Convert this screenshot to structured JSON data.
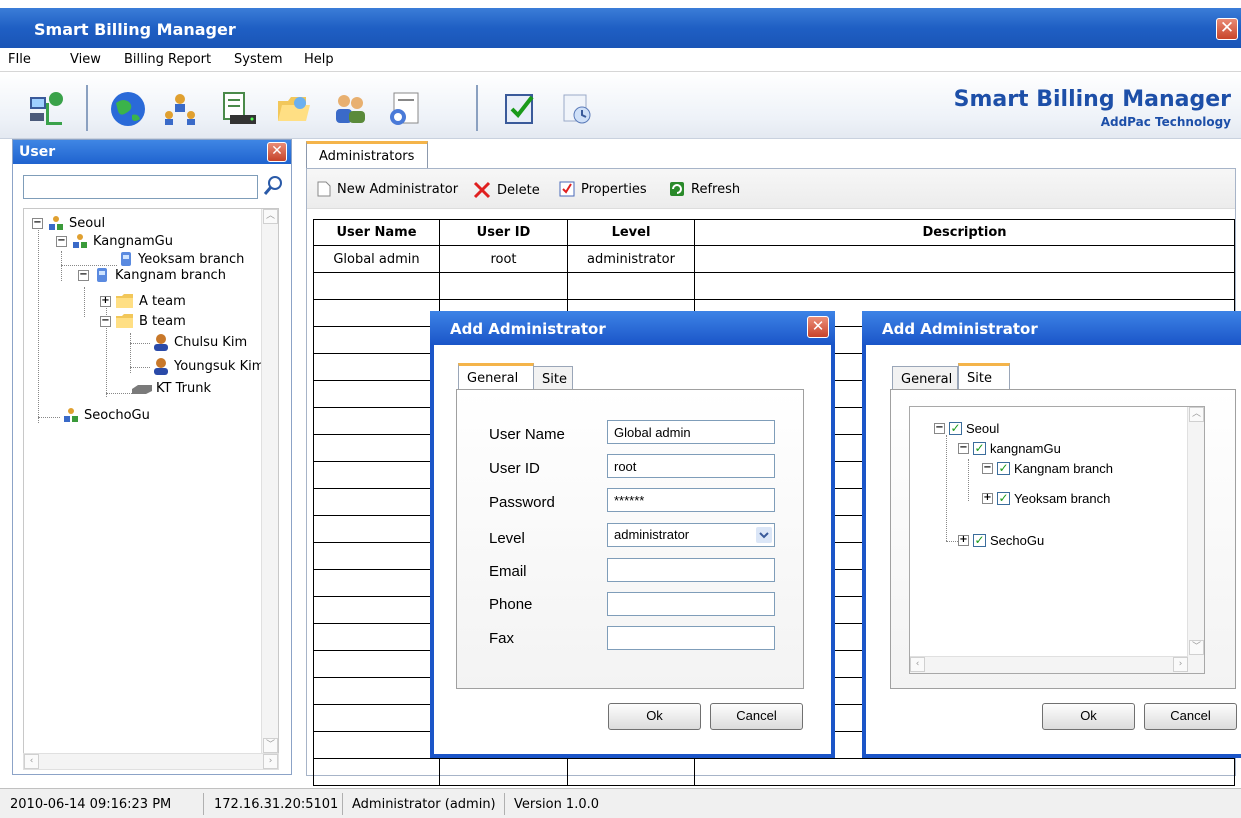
{
  "window": {
    "title": "Smart Billing Manager"
  },
  "menu": [
    "FIle",
    "View",
    "Billing Report",
    "System",
    "Help"
  ],
  "toolbar": {
    "icons": [
      "network-icon",
      "globe-icon",
      "users-network-icon",
      "device-icon",
      "folder-icon",
      "users-icon",
      "user-card-icon",
      "checklist-icon",
      "report-icon"
    ],
    "brand_title": "Smart Billing Manager",
    "brand_subtitle": "AddPac Technology"
  },
  "user_panel": {
    "title": "User",
    "search_value": "",
    "tree": [
      {
        "label": "Seoul"
      },
      {
        "label": "KangnamGu"
      },
      {
        "label": "Yeoksam branch"
      },
      {
        "label": "Kangnam branch"
      },
      {
        "label": "A team"
      },
      {
        "label": "B team"
      },
      {
        "label": "Chulsu Kim"
      },
      {
        "label": "Youngsuk Kim"
      },
      {
        "label": "KT Trunk"
      },
      {
        "label": "SeochoGu"
      }
    ]
  },
  "main": {
    "tab": "Administrators",
    "actions": {
      "new": "New Administrator",
      "delete": "Delete",
      "properties": "Properties",
      "refresh": "Refresh"
    },
    "columns": [
      "User Name",
      "User ID",
      "Level",
      "Description"
    ],
    "rows": [
      [
        "Global admin",
        "root",
        "administrator",
        ""
      ]
    ]
  },
  "dialog_general": {
    "title": "Add Administrator",
    "tabs": [
      "General",
      "Site"
    ],
    "fields": {
      "user_name_label": "User Name",
      "user_name_value": "Global admin",
      "user_id_label": "User ID",
      "user_id_value": "root",
      "password_label": "Password",
      "password_value": "******",
      "level_label": "Level",
      "level_value": "administrator",
      "email_label": "Email",
      "email_value": "",
      "phone_label": "Phone",
      "phone_value": "",
      "fax_label": "Fax",
      "fax_value": ""
    },
    "ok": "Ok",
    "cancel": "Cancel"
  },
  "dialog_site": {
    "title": "Add Administrator",
    "tabs": [
      "General",
      "Site"
    ],
    "tree": [
      "Seoul",
      "kangnamGu",
      "Kangnam branch",
      "Yeoksam branch",
      "SechoGu"
    ],
    "ok": "Ok",
    "cancel": "Cancel"
  },
  "status": {
    "datetime": "2010-06-14 09:16:23 PM",
    "address": "172.16.31.20:5101",
    "user": "Administrator (admin)",
    "version": "Version 1.0.0"
  }
}
